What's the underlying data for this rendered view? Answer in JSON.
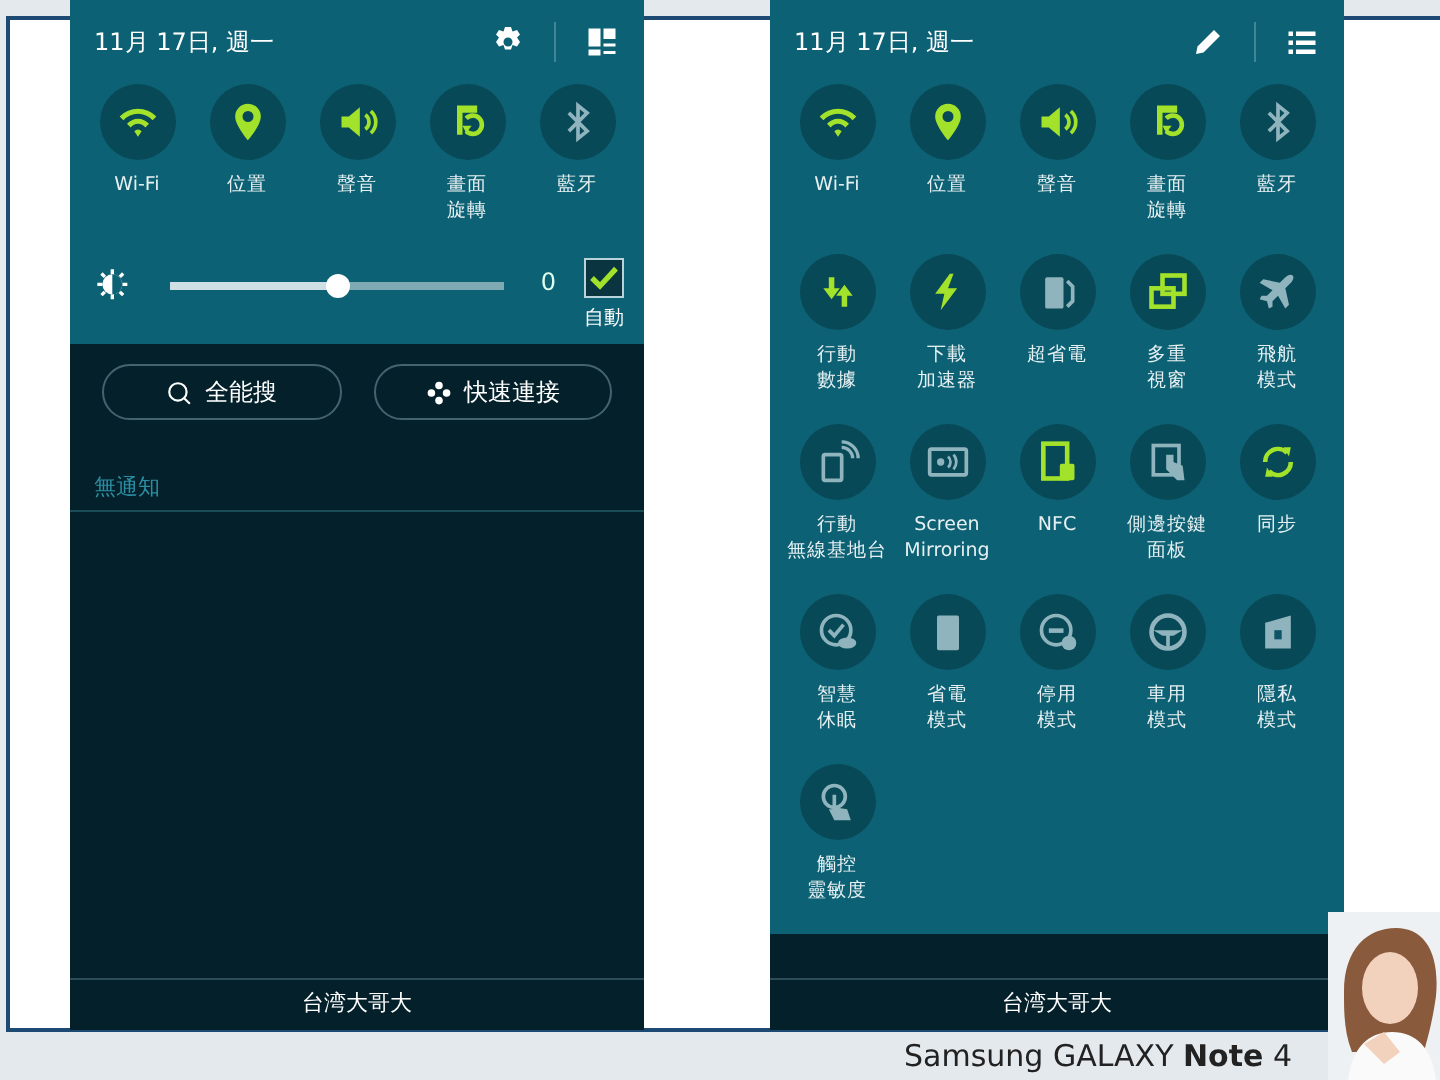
{
  "left_panel": {
    "date": "11月 17日, 週一",
    "quick_settings": [
      {
        "label": "Wi-Fi",
        "on": true
      },
      {
        "label": "位置",
        "on": true
      },
      {
        "label": "聲音",
        "on": true
      },
      {
        "label": [
          "畫面",
          "旋轉"
        ],
        "on": true
      },
      {
        "label": "藍牙",
        "on": false
      }
    ],
    "brightness": {
      "level": 0.5,
      "reading": "0",
      "auto_label": "自動",
      "auto_checked": true
    },
    "buttons": [
      "全能搜",
      "快速連接"
    ],
    "notifications_header": "無通知",
    "carrier": "台湾大哥大"
  },
  "right_panel": {
    "date": "11月 17日, 週一",
    "quick_settings": [
      {
        "label": "Wi-Fi",
        "on": true
      },
      {
        "label": "位置",
        "on": true
      },
      {
        "label": "聲音",
        "on": true
      },
      {
        "label": [
          "畫面",
          "旋轉"
        ],
        "on": true
      },
      {
        "label": "藍牙",
        "on": false
      },
      {
        "label": [
          "行動",
          "數據"
        ],
        "on": true
      },
      {
        "label": [
          "下載",
          "加速器"
        ],
        "on": true
      },
      {
        "label": "超省電",
        "on": false
      },
      {
        "label": [
          "多重",
          "視窗"
        ],
        "on": true
      },
      {
        "label": [
          "飛航",
          "模式"
        ],
        "on": false
      },
      {
        "label": [
          "行動",
          "無線基地台"
        ],
        "on": false
      },
      {
        "label": "Screen Mirroring",
        "on": false
      },
      {
        "label": "NFC",
        "on": true
      },
      {
        "label": [
          "側邊按鍵",
          "面板"
        ],
        "on": false
      },
      {
        "label": "同步",
        "on": true
      },
      {
        "label": [
          "智慧",
          "休眠"
        ],
        "on": false
      },
      {
        "label": [
          "省電",
          "模式"
        ],
        "on": false
      },
      {
        "label": [
          "停用",
          "模式"
        ],
        "on": false
      },
      {
        "label": [
          "車用",
          "模式"
        ],
        "on": false
      },
      {
        "label": [
          "隱私",
          "模式"
        ],
        "on": false
      },
      {
        "label": [
          "觸控",
          "靈敏度"
        ],
        "on": false
      }
    ],
    "carrier": "台湾大哥大"
  },
  "banner": {
    "text": "Samsung GALAXY **Note** 4"
  }
}
